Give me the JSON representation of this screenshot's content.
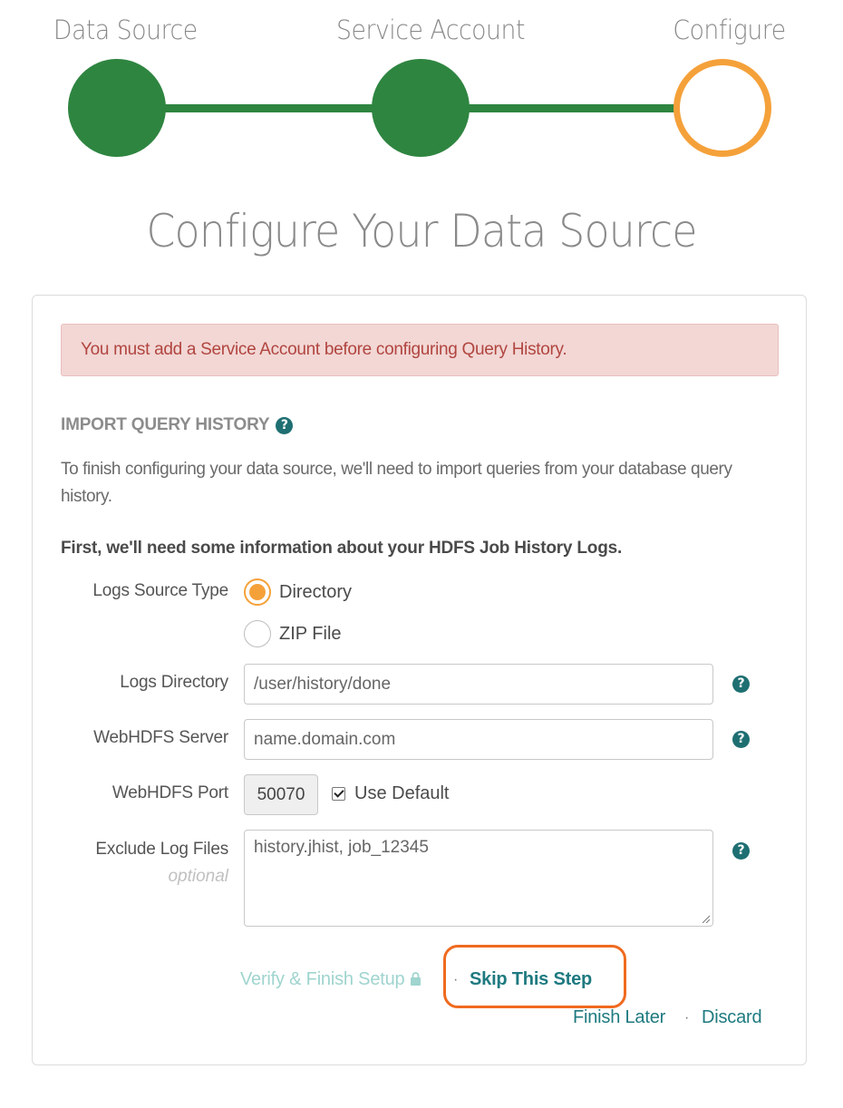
{
  "stepper": {
    "steps": [
      {
        "label": "Data Source",
        "state": "complete"
      },
      {
        "label": "Service Account",
        "state": "complete"
      },
      {
        "label": "Configure",
        "state": "current"
      }
    ],
    "complete_color": "#2e8540",
    "current_color": "#f5a13a"
  },
  "page_title": "Configure Your Data Source",
  "alert": {
    "text": "You must add a Service Account before configuring Query History."
  },
  "section": {
    "title": "IMPORT QUERY HISTORY",
    "help_icon": "question-circle-icon",
    "intro": "To finish configuring your data source, we'll need to import queries from your database query history.",
    "instruction": "First, we'll need some information about your HDFS Job History Logs."
  },
  "form": {
    "logs_source_type": {
      "label": "Logs Source Type",
      "options": [
        {
          "label": "Directory",
          "selected": true
        },
        {
          "label": "ZIP File",
          "selected": false
        }
      ]
    },
    "logs_directory": {
      "label": "Logs Directory",
      "placeholder": "/user/history/done"
    },
    "webhdfs_server": {
      "label": "WebHDFS Server",
      "placeholder": "name.domain.com"
    },
    "webhdfs_port": {
      "label": "WebHDFS Port",
      "value": "50070",
      "use_default_label": "Use Default",
      "use_default_checked": true
    },
    "exclude_log_files": {
      "label": "Exclude Log Files",
      "sublabel": "optional",
      "placeholder": "history.jhist, job_12345"
    }
  },
  "footer": {
    "verify_label": "Verify & Finish Setup",
    "lock_icon": "lock-icon",
    "skip_label": "Skip This Step",
    "finish_later_label": "Finish Later",
    "discard_label": "Discard",
    "separator": "·"
  },
  "colors": {
    "accent": "#1e7a80",
    "alert_bg": "#f2d7d5",
    "alert_text": "#b1453f",
    "highlight": "#ef6a1f"
  }
}
